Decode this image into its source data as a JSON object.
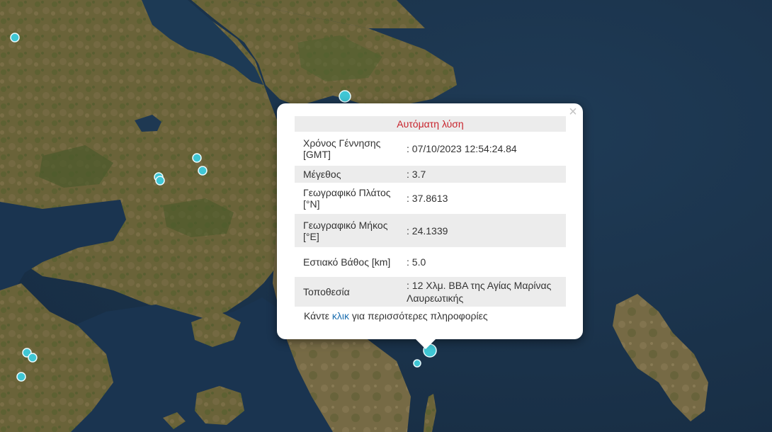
{
  "popup": {
    "title": "Αυτόματη λύση",
    "close_glyph": "×",
    "rows": [
      {
        "label": "Χρόνος Γέννησης [GMT]",
        "value": ": 07/10/2023 12:54:24.84"
      },
      {
        "label": "Μέγεθος",
        "value": ": 3.7"
      },
      {
        "label": "Γεωγραφικό Πλάτος [°N]",
        "value": ": 37.8613"
      },
      {
        "label": "Γεωγραφικό Μήκος [°E]",
        "value": ": 24.1339"
      },
      {
        "label": "Εστιακό Βάθος [km]",
        "value": ": 5.0"
      },
      {
        "label": "Τοποθεσία",
        "value": ": 12 Χλμ. ΒΒΑ της Αγίας Μαρίνας Λαυρεωτικής"
      }
    ],
    "footer": {
      "before": "Κάντε ",
      "link": "κλικ",
      "after": " για περισσότερες πληροφορίες"
    }
  },
  "map": {
    "marker_color": "#3fc6d4",
    "sea_color": "#1d3750",
    "land_color": "#6b6438"
  }
}
